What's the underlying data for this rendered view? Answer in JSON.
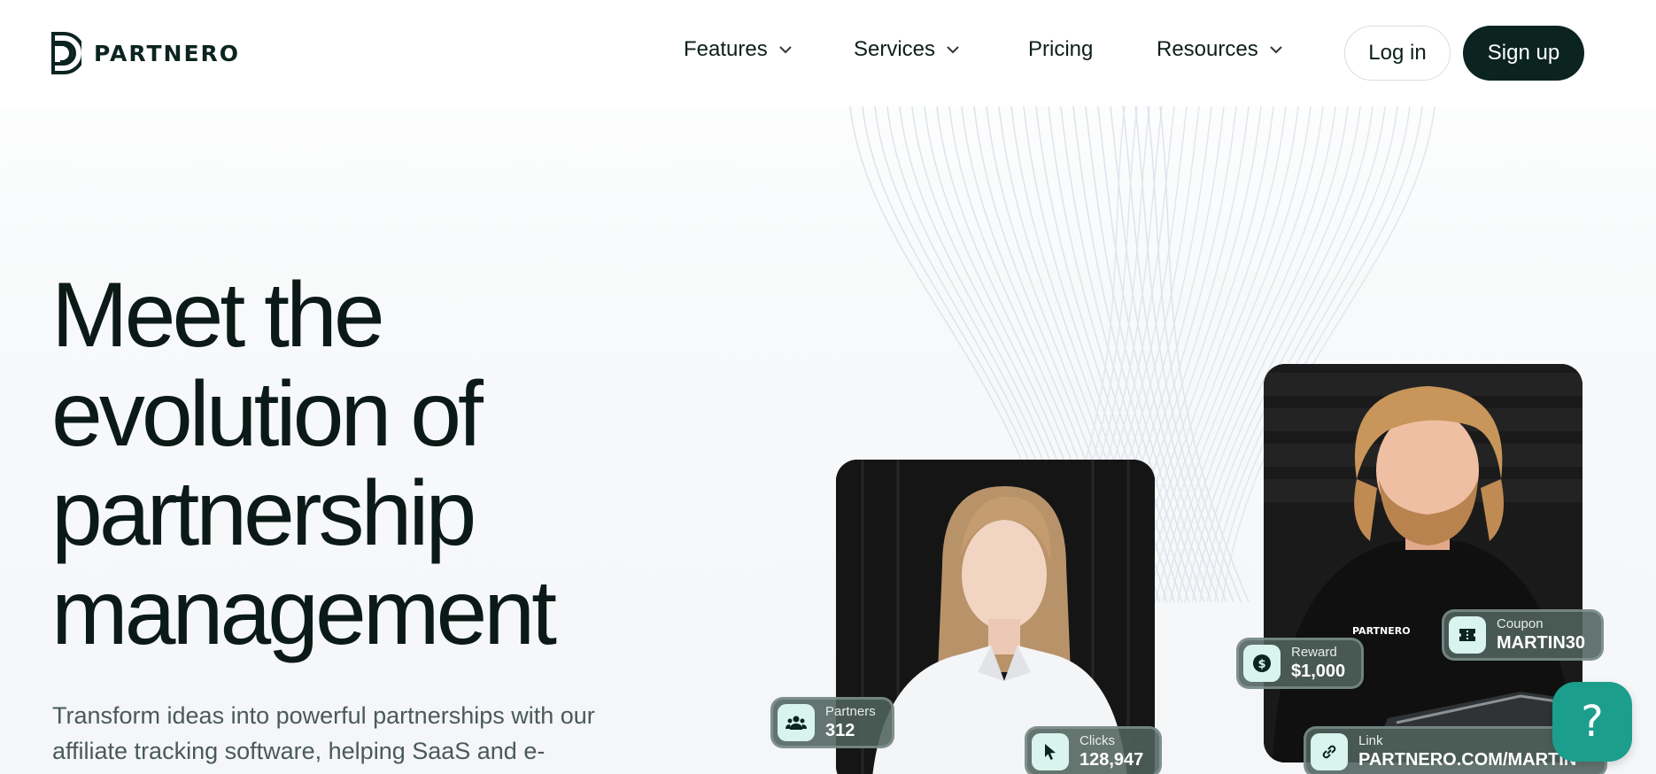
{
  "brand": {
    "name": "PARTNERO"
  },
  "nav": {
    "items": [
      {
        "label": "Features",
        "has_dropdown": true
      },
      {
        "label": "Services",
        "has_dropdown": true
      },
      {
        "label": "Pricing",
        "has_dropdown": false
      },
      {
        "label": "Resources",
        "has_dropdown": true
      }
    ],
    "login_label": "Log in",
    "signup_label": "Sign up"
  },
  "hero": {
    "title_lines": [
      "Meet the",
      "evolution of",
      "partnership",
      "management"
    ],
    "subtitle_line1": "Transform ideas into powerful partnerships with our",
    "subtitle_line2": "affiliate tracking software, helping SaaS and e-"
  },
  "stats": {
    "partners": {
      "label": "Partners",
      "value": "312",
      "icon": "users-icon"
    },
    "clicks": {
      "label": "Clicks",
      "value": "128,947",
      "icon": "cursor-icon"
    },
    "reward": {
      "label": "Reward",
      "value": "$1,000",
      "icon": "dollar-icon"
    },
    "coupon": {
      "label": "Coupon",
      "value": "MARTIN30",
      "icon": "ticket-icon"
    },
    "link": {
      "label": "Link",
      "value": "PARTNERO.COM/MARTIN",
      "icon": "link-icon"
    }
  },
  "shirt_logo": "PARTNERO",
  "help": {
    "label": "?",
    "icon": "help-icon"
  },
  "colors": {
    "brand_dark": "#0b2420",
    "accent_teal": "#1c9e8c",
    "stat_card": "#50625c"
  }
}
